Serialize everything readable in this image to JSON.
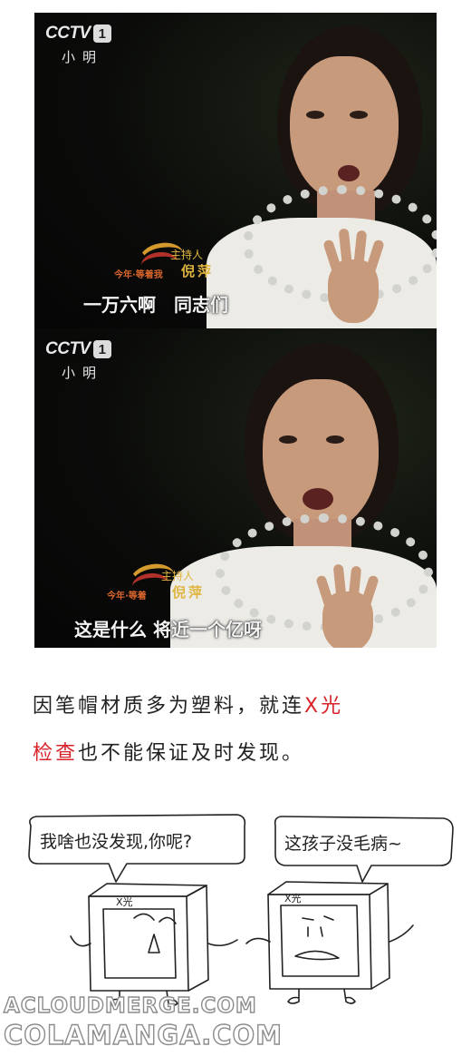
{
  "panels": [
    {
      "channel_logo": "CCTV",
      "channel_number": "1",
      "speaker_tag": "小明",
      "host_role": "主持人",
      "host_name": "倪萍",
      "show_name": "今年·等着我",
      "subtitle": "一万六啊　同志们"
    },
    {
      "channel_logo": "CCTV",
      "channel_number": "1",
      "speaker_tag": "小明",
      "host_role": "主持人",
      "host_name": "倪萍",
      "show_name": "今年·等着",
      "subtitle": "这是什么 将近一个亿呀"
    }
  ],
  "caption": {
    "line1_main": "因笔帽材质多为塑料，就连",
    "line1_highlight": "X光",
    "line2_highlight": "检查",
    "line2_main": "也不能保证及时发现。",
    "highlight_color": "#d8232a"
  },
  "comic": {
    "left_bubble": "我啥也没发现,你呢?",
    "right_bubble": "这孩子没毛病~",
    "left_machine_label": "X光",
    "right_machine_label": "X光"
  },
  "watermarks": [
    "ACLOUDMERGE.COM",
    "COLAMANGA.COM"
  ]
}
